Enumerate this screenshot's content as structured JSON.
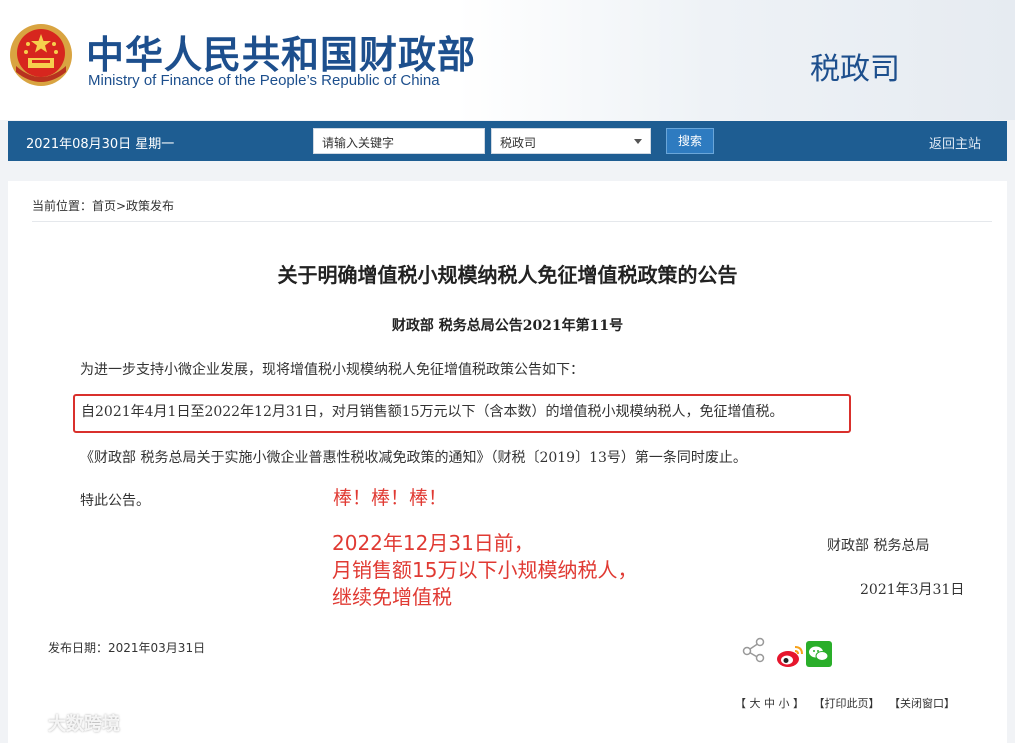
{
  "header": {
    "site_title_cn": "中华人民共和国财政部",
    "site_title_en": "Ministry of Finance of the People’s Republic of China",
    "dept": "税政司"
  },
  "nav": {
    "date": "2021年08月30日  星期一",
    "search_placeholder": "请输入关键字",
    "select_value": "税政司",
    "search_button": "搜索",
    "return_link": "返回主站"
  },
  "breadcrumb": "当前位置：首页>政策发布",
  "article": {
    "title": "关于明确增值税小规模纳税人免征增值税政策的公告",
    "doc_number": "财政部  税务总局公告2021年第11号",
    "para1": "为进一步支持小微企业发展，现将增值税小规模纳税人免征增值税政策公告如下：",
    "para2": "自2021年4月1日至2022年12月31日，对月销售额15万元以下（含本数）的增值税小规模纳税人，免征增值税。",
    "para3": "《财政部 税务总局关于实施小微企业普惠性税收减免政策的通知》（财税〔2019〕13号）第一条同时废止。",
    "para4": "特此公告。",
    "signer": "财政部    税务总局",
    "sign_date": "2021年3月31日"
  },
  "annotation": {
    "line1": "棒！棒！棒！",
    "line2a": "2022年12月31日前，",
    "line2b": "月销售额15万以下小规模纳税人，",
    "line2c": "继续免增值税"
  },
  "footer": {
    "publish_date": "发布日期：2021年03月31日",
    "font_size_tool": "【 大 中 小 】",
    "print_tool": "【打印此页】",
    "close_tool": "【关闭窗口】"
  },
  "watermark": "大数跨境",
  "colors": {
    "brand_blue": "#1d4f8d",
    "nav_bg": "#1e5d92",
    "highlight_red": "#d9302c"
  },
  "icons": [
    "national-emblem-icon",
    "share-icon",
    "weibo-icon",
    "wechat-icon",
    "watermark-logo-icon"
  ]
}
